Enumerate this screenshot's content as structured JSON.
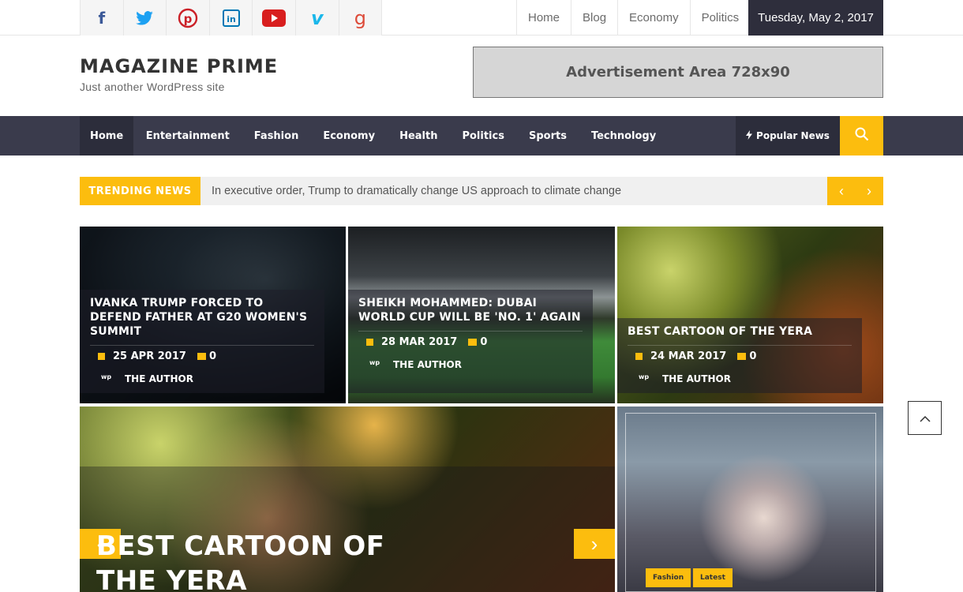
{
  "social": {
    "items": [
      {
        "icon": "facebook-icon",
        "glyph": "f",
        "color": "#3b5998"
      },
      {
        "icon": "twitter-icon",
        "glyph": "🐦",
        "color": "#1da1f2"
      },
      {
        "icon": "pinterest-icon",
        "glyph": "P",
        "color": "#cb2027"
      },
      {
        "icon": "linkedin-icon",
        "glyph": "in",
        "color": "#0077b5"
      },
      {
        "icon": "youtube-icon",
        "glyph": "▶",
        "color": "#e62117"
      },
      {
        "icon": "vimeo-icon",
        "glyph": "v",
        "color": "#1ab7ea"
      },
      {
        "icon": "google-plus-icon",
        "glyph": "g",
        "color": "#dd4b39"
      }
    ]
  },
  "topnav": {
    "items": [
      "Home",
      "Blog",
      "Economy",
      "Politics"
    ],
    "date": "Tuesday, May 2, 2017"
  },
  "site": {
    "title": "MAGAZINE PRIME",
    "tagline": "Just another WordPress site"
  },
  "ad": {
    "label": "Advertisement Area 728x90"
  },
  "menu": {
    "items": [
      "Home",
      "Entertainment",
      "Fashion",
      "Economy",
      "Health",
      "Politics",
      "Sports",
      "Technology"
    ],
    "popular": "Popular News"
  },
  "trending": {
    "label": "TRENDING NEWS",
    "headline": "In executive order, Trump to dramatically change US approach to climate change",
    "prev": "‹",
    "next": "›"
  },
  "cards": [
    {
      "title": "IVANKA TRUMP FORCED TO DEFEND FATHER AT G20 WOMEN'S SUMMIT",
      "date": "25 APR 2017",
      "comments": "0",
      "author": "THE AUTHOR",
      "avatar": "wp"
    },
    {
      "title": "SHEIKH MOHAMMED: DUBAI WORLD CUP WILL BE 'NO. 1' AGAIN",
      "date": "28 MAR 2017",
      "comments": "0",
      "author": "THE AUTHOR",
      "avatar": "wp"
    },
    {
      "title": "BEST CARTOON OF THE YERA",
      "date": "24 MAR 2017",
      "comments": "0",
      "author": "THE AUTHOR",
      "avatar": "wp"
    }
  ],
  "slider": {
    "title": "BEST CARTOON OF THE YERA",
    "prev": "‹",
    "next": "›"
  },
  "side": {
    "tags": [
      "Fashion",
      "Latest"
    ]
  },
  "colors": {
    "accent": "#fcbd0e",
    "nav": "#3a3b4c",
    "dark": "#2e2e3c"
  }
}
